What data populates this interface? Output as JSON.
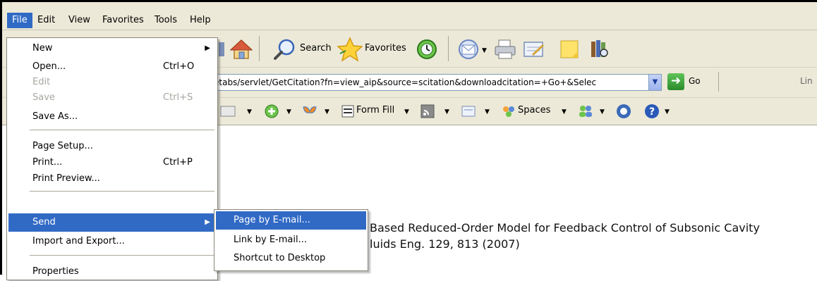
{
  "menubar": {
    "items": [
      "File",
      "Edit",
      "View",
      "Favorites",
      "Tools",
      "Help"
    ],
    "active": "File"
  },
  "toolbar": {
    "search_label": "Search",
    "favorites_label": "Favorites",
    "icons": [
      "home-icon",
      "search-icon",
      "favorites-star-icon",
      "history-icon",
      "mail-icon",
      "print-icon",
      "edit-icon",
      "notes-icon",
      "research-icon"
    ]
  },
  "address_bar": {
    "url": "etabs/servlet/GetCitation?fn=view_aip&source=scitation&downloadcitation=+Go+&Selec",
    "go_label": "Go",
    "links_label": "Lin"
  },
  "secondary_toolbar": {
    "form_fill_label": "Form Fill",
    "spaces_label": "Spaces"
  },
  "content": {
    "line1": "Based Reduced-Order Model for Feedback Control of Subsonic Cavity",
    "line2": "luids Eng. 129, 813 (2007)"
  },
  "file_menu": {
    "new": "New",
    "open": "Open...",
    "open_shortcut": "Ctrl+O",
    "edit": "Edit",
    "save": "Save",
    "save_shortcut": "Ctrl+S",
    "save_as": "Save As...",
    "page_setup": "Page Setup...",
    "print": "Print...",
    "print_shortcut": "Ctrl+P",
    "print_preview": "Print Preview...",
    "send": "Send",
    "import_export": "Import and Export...",
    "properties": "Properties"
  },
  "send_submenu": {
    "page_by_email": "Page by E-mail...",
    "link_by_email": "Link by E-mail...",
    "shortcut_to_desktop": "Shortcut to Desktop"
  },
  "colors": {
    "menu_bg": "#ece9d8",
    "highlight": "#316ac5",
    "disabled_text": "#a7a6a0"
  }
}
